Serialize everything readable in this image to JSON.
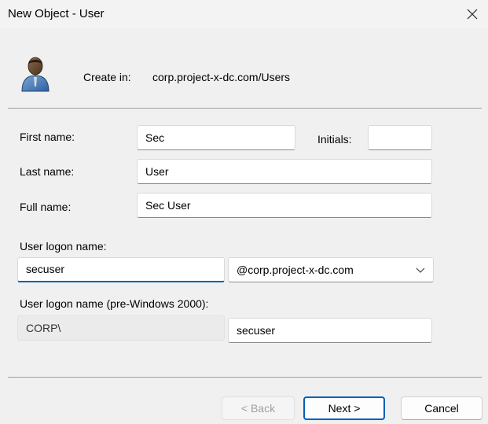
{
  "window": {
    "title": "New Object - User",
    "close_glyph": "✕"
  },
  "header": {
    "icon": "user-icon",
    "create_in_label": "Create in:",
    "create_in_value": "corp.project-x-dc.com/Users"
  },
  "form": {
    "first_name_label": "First name:",
    "first_name_value": "Sec",
    "initials_label": "Initials:",
    "initials_value": "",
    "last_name_label": "Last name:",
    "last_name_value": "User",
    "full_name_label": "Full name:",
    "full_name_value": "Sec User",
    "logon_name_label": "User logon name:",
    "logon_name_value": "secuser",
    "domain_suffix_value": "@corp.project-x-dc.com",
    "pre2000_label": "User logon name (pre-Windows 2000):",
    "pre2000_domain_value": "CORP\\",
    "pre2000_name_value": "secuser"
  },
  "buttons": {
    "back_label": "< Back",
    "next_label": "Next >",
    "cancel_label": "Cancel"
  },
  "colors": {
    "accent": "#005fb8",
    "background": "#f0f0f0"
  }
}
